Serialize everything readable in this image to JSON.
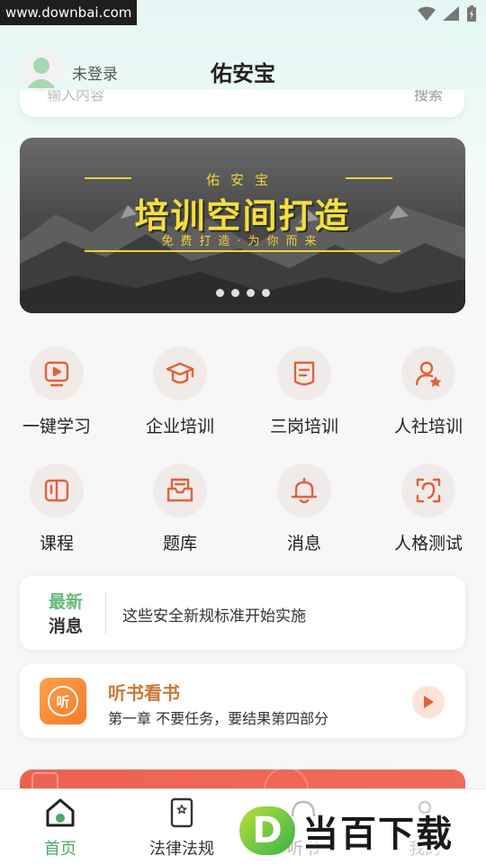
{
  "status_bar": {
    "watermark": "www.downbai.com"
  },
  "header": {
    "login_label": "未登录",
    "title": "佑安宝"
  },
  "search": {
    "placeholder_peek": "输入内容",
    "button_peek": "搜索"
  },
  "banner": {
    "sub_title": "佑安宝",
    "main_title": "培训空间打造",
    "tagline": "免费打造·为你而来",
    "slide_count": 4,
    "active_slide": 3
  },
  "grid": [
    {
      "label": "一键学习",
      "icon": "play-screen-icon"
    },
    {
      "label": "企业培训",
      "icon": "graduation-cap-icon"
    },
    {
      "label": "三岗培训",
      "icon": "document-icon"
    },
    {
      "label": "人社培训",
      "icon": "user-star-icon"
    },
    {
      "label": "课程",
      "icon": "book-icon"
    },
    {
      "label": "题库",
      "icon": "inbox-icon"
    },
    {
      "label": "消息",
      "icon": "bell-icon"
    },
    {
      "label": "人格测试",
      "icon": "face-scan-icon"
    }
  ],
  "news": {
    "tag_line1": "最新",
    "tag_line2": "消息",
    "text": "这些安全新规标准开始实施"
  },
  "audio": {
    "icon_text": "听",
    "title": "听书看书",
    "subtitle": "第一章 不要任务，要结果第四部分"
  },
  "bottom_nav": [
    {
      "label": "首页",
      "active": true,
      "icon": "home-icon"
    },
    {
      "label": "法律法规",
      "active": false,
      "icon": "law-document-icon"
    },
    {
      "label": "听书",
      "active": false,
      "icon": "headphones-icon"
    },
    {
      "label": "我的",
      "active": false,
      "icon": "user-icon"
    }
  ],
  "watermark_logo": {
    "letter": "D",
    "text": "当百下载"
  },
  "colors": {
    "accent_green": "#4cab62",
    "icon_orange": "#e0623a",
    "banner_yellow": "#f6e03a"
  }
}
